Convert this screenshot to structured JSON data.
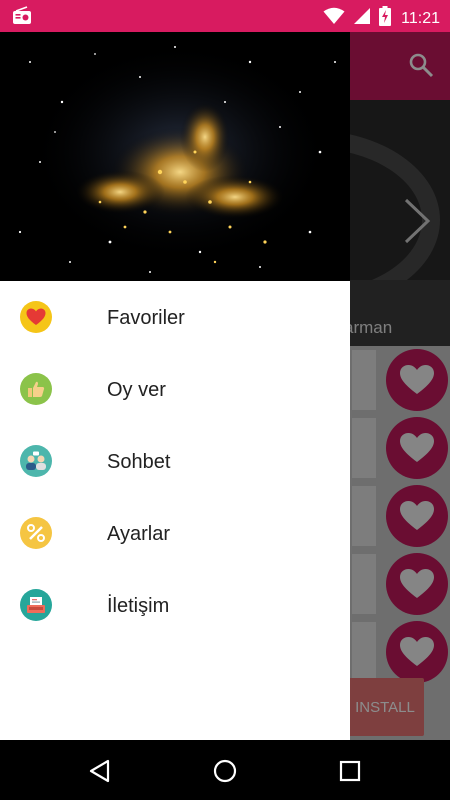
{
  "status_bar": {
    "time": "11:21",
    "icons": [
      "radio-icon",
      "wifi-icon",
      "signal-icon",
      "battery-charging-icon"
    ]
  },
  "app": {
    "toolbar_icon": "search-icon",
    "banner_caption": "arman",
    "install_label": "INSTALL",
    "row_icon": "heart-icon"
  },
  "drawer": {
    "items": [
      {
        "label": "Favoriler",
        "icon": "heart-icon",
        "icon_bg": "#f5c518"
      },
      {
        "label": "Oy ver",
        "icon": "thumbs-up-icon",
        "icon_bg": "#8bc34a"
      },
      {
        "label": "Sohbet",
        "icon": "chat-people-icon",
        "icon_bg": "#4db6ac"
      },
      {
        "label": "Ayarlar",
        "icon": "tools-icon",
        "icon_bg": "#f5c542"
      },
      {
        "label": "İletişim",
        "icon": "contact-icon",
        "icon_bg": "#26a69a"
      }
    ]
  },
  "nav_bar": {
    "buttons": [
      "back-icon",
      "home-icon",
      "recents-icon"
    ]
  },
  "colors": {
    "status_bar": "#d81b60",
    "toolbar": "#c2185b",
    "accent": "#c2185b"
  }
}
